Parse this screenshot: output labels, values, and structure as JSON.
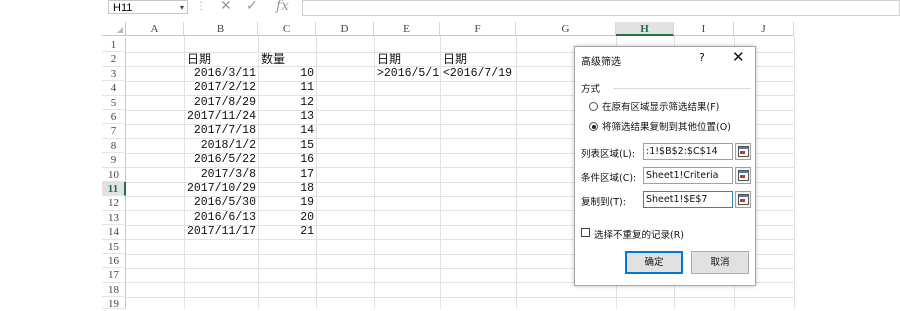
{
  "formula_bar": {
    "name_box": "H11",
    "name_box_arrow": "▾",
    "separator": "⋮",
    "cancel_glyph": "✕",
    "enter_glyph": "✓",
    "fx_label": "fx"
  },
  "columns": [
    "A",
    "B",
    "C",
    "D",
    "E",
    "F",
    "G",
    "H",
    "I",
    "J"
  ],
  "selected_column": "H",
  "rows": [
    "1",
    "2",
    "3",
    "4",
    "5",
    "6",
    "7",
    "8",
    "9",
    "10",
    "11",
    "12",
    "13",
    "14",
    "15",
    "16",
    "17",
    "18",
    "19"
  ],
  "selected_row": "11",
  "table": {
    "header_date": "日期",
    "header_qty": "数量",
    "dates": [
      "2016/3/11",
      "2017/2/12",
      "2017/8/29",
      "2017/11/24",
      "2017/7/18",
      "2018/1/2",
      "2016/5/22",
      "2017/3/8",
      "2017/10/29",
      "2016/5/30",
      "2016/6/13",
      "2017/11/17"
    ],
    "quantities": [
      "10",
      "11",
      "12",
      "13",
      "14",
      "15",
      "16",
      "17",
      "18",
      "19",
      "20",
      "21"
    ]
  },
  "criteria": {
    "header_e": "日期",
    "header_f": "日期",
    "value_e": ">2016/5/1",
    "value_f": "<2016/7/19"
  },
  "dialog": {
    "title": "高级筛选",
    "help": "?",
    "close": "✕",
    "section_method": "方式",
    "radio_inplace": "在原有区域显示筛选结果(F)",
    "radio_copy": "将筛选结果复制到其他位置(O)",
    "list_range_label": "列表区域(L):",
    "list_range_value": ":1!$B$2:$C$14",
    "criteria_range_label": "条件区域(C):",
    "criteria_range_value": "Sheet1!Criteria",
    "copy_to_label": "复制到(T):",
    "copy_to_value": "Sheet1!$E$7",
    "unique_label": "选择不重复的记录(R)",
    "ok_label": "确定",
    "cancel_label": "取消"
  }
}
